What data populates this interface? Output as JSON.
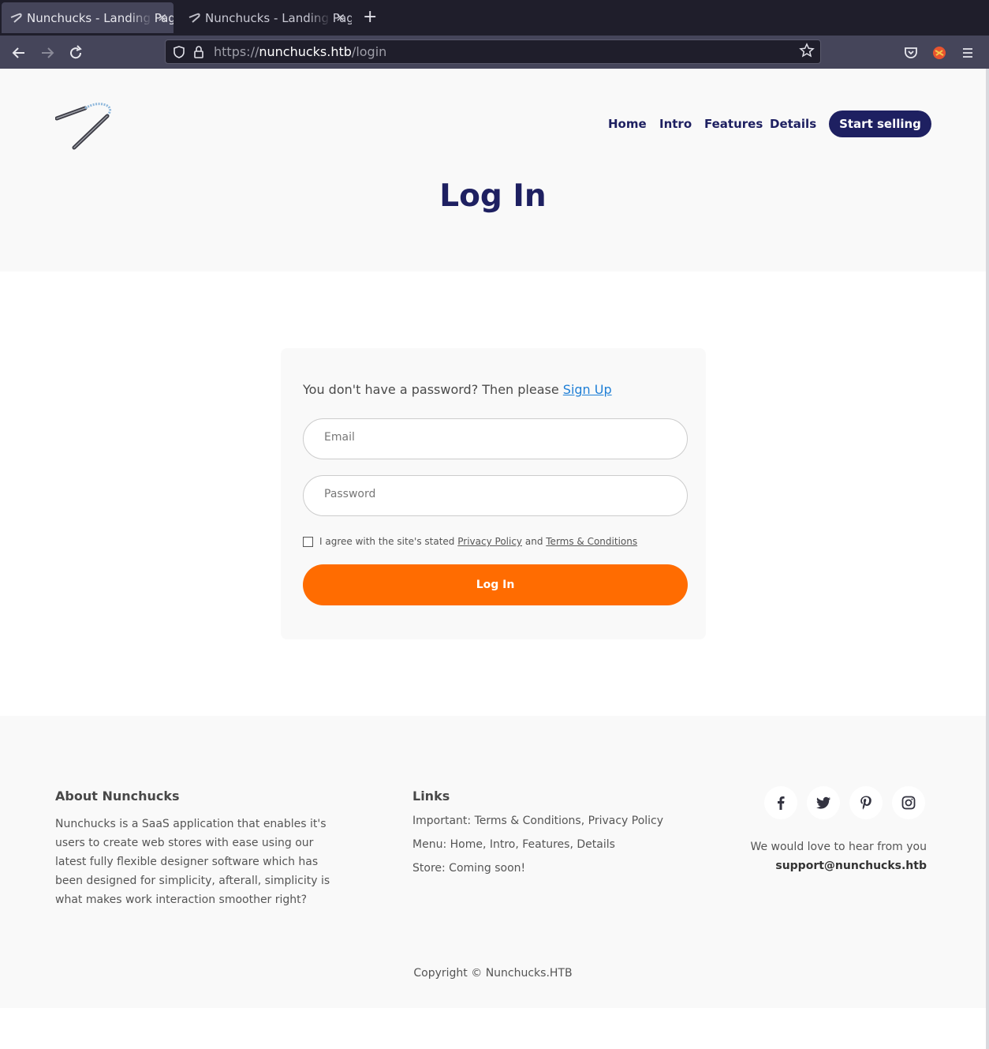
{
  "browser": {
    "tabs": [
      {
        "title": "Nunchucks - Landing Page",
        "active": true
      },
      {
        "title": "Nunchucks - Landing Page",
        "active": false
      }
    ],
    "new_tab_icon": "+",
    "close_icon": "×",
    "url_scheme": "https://",
    "url_host": "nunchucks.htb",
    "url_path": "/login"
  },
  "header": {
    "logo": "nunchucks-logo",
    "nav": [
      "Home",
      "Intro",
      "Features",
      "Details"
    ],
    "cta_label": "Start selling"
  },
  "page_title": "Log In",
  "login_form": {
    "prompt": "You don't have a password? Then please",
    "signup_link": "Sign Up",
    "email_placeholder": "Email",
    "password_placeholder": "Password",
    "agree_prefix": "I agree with the site's stated",
    "privacy_link": "Privacy Policy",
    "agree_and": "and",
    "terms_link": "Terms & Conditions",
    "submit_label": "Log In"
  },
  "footer": {
    "about_title": "About Nunchucks",
    "about_text": "Nunchucks is a SaaS application that enables it's users to create web stores with ease using our latest fully flexible designer software which has been designed for simplicity, afterall, simplicity is what makes work interaction smoother right?",
    "links_title": "Links",
    "links": [
      "Important: Terms & Conditions, Privacy Policy",
      "Menu: Home, Intro, Features, Details",
      "Store: Coming soon!"
    ],
    "social": [
      "facebook-icon",
      "twitter-icon",
      "pinterest-icon",
      "instagram-icon"
    ],
    "contact_text": "We would love to hear from you",
    "contact_email": "support@nunchucks.htb",
    "copyright": "Copyright © Nunchucks.HTB"
  },
  "colors": {
    "brand_navy": "#1e2061",
    "accent_orange": "#ff6c01",
    "link_blue": "#1f7fd6",
    "browser_dark": "#1f1e2b",
    "browser_toolbar": "#45455a"
  }
}
